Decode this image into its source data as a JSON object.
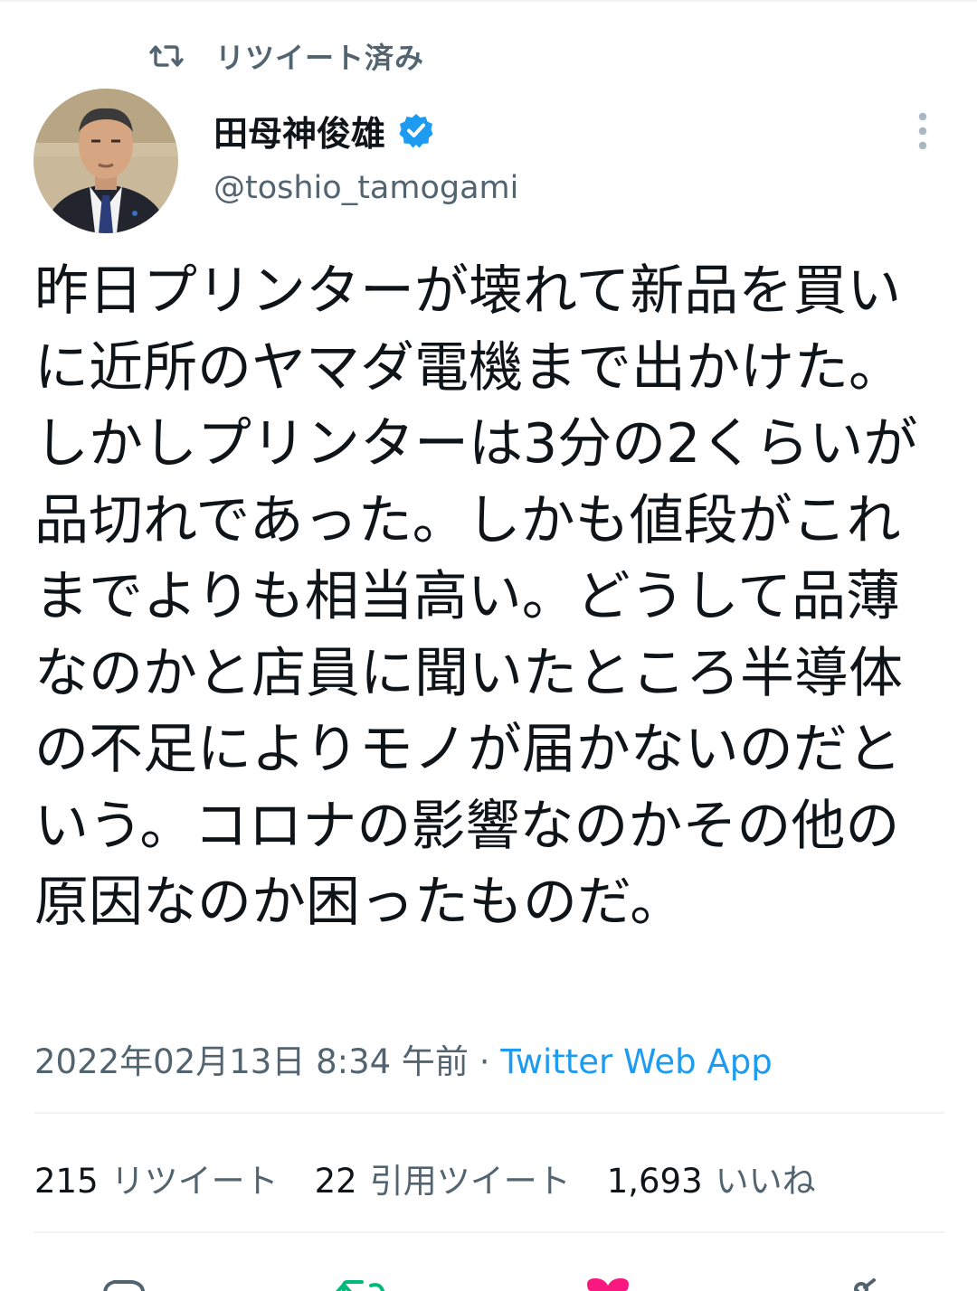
{
  "retweet_context": {
    "label": "リツイート済み",
    "icon": "retweet-icon"
  },
  "author": {
    "display_name": "田母神俊雄",
    "handle": "@toshio_tamogami",
    "verified": true,
    "avatar_icon": "avatar"
  },
  "tweet": {
    "text": "昨日プリンターが壊れて新品を買いに近所のヤマダ電機まで出かけた。しかしプリンターは3分の2くらいが品切れであった。しかも値段がこれまでよりも相当高い。どうして品薄なのかと店員に聞いたところ半導体の不足によりモノが届かないのだという。コロナの影響なのかその他の原因なのか困ったものだ。",
    "timestamp": "2022年02月13日 8:34 午前",
    "separator": " · ",
    "source": "Twitter Web App"
  },
  "stats": [
    {
      "count": "215",
      "label": "リツイート"
    },
    {
      "count": "22",
      "label": "引用ツイート"
    },
    {
      "count": "1,693",
      "label": "いいね"
    }
  ],
  "actions": [
    "reply-icon",
    "retweet-icon",
    "like-icon",
    "share-icon"
  ],
  "colors": {
    "primary_text": "#0f1419",
    "secondary_text": "#536471",
    "link": "#1d9bf0",
    "retweet_green": "#00ba7c",
    "like_pink": "#f91880",
    "divider": "#eff3f4"
  }
}
